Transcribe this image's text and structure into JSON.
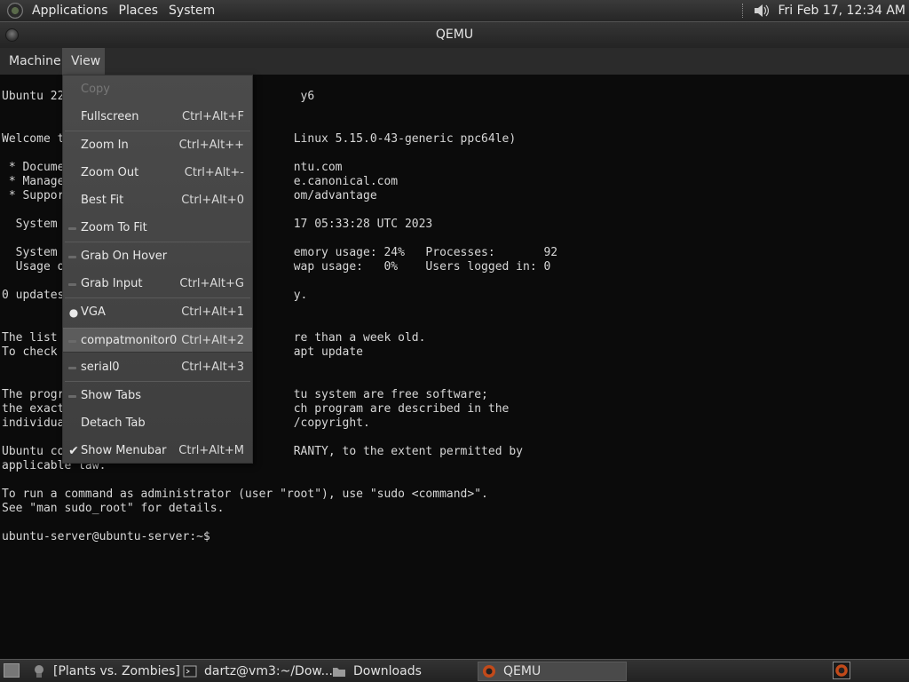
{
  "top_panel": {
    "menus": [
      "Applications",
      "Places",
      "System"
    ],
    "clock": "Fri Feb 17, 12:34 AM"
  },
  "window": {
    "title": "QEMU"
  },
  "menubar": {
    "items": [
      "Machine",
      "View"
    ]
  },
  "view_menu": {
    "items": [
      {
        "label": "Copy",
        "shortcut": "",
        "disabled": true,
        "mark": ""
      },
      {
        "label": "Fullscreen",
        "shortcut": "Ctrl+Alt+F",
        "mark": ""
      },
      {
        "label": "Zoom In",
        "shortcut": "Ctrl+Alt++",
        "mark": ""
      },
      {
        "label": "Zoom Out",
        "shortcut": "Ctrl+Alt+-",
        "mark": ""
      },
      {
        "label": "Best Fit",
        "shortcut": "Ctrl+Alt+0",
        "mark": ""
      },
      {
        "label": "Zoom To Fit",
        "shortcut": "",
        "mark": "toggle-off"
      },
      {
        "label": "Grab On Hover",
        "shortcut": "",
        "mark": "toggle-off"
      },
      {
        "label": "Grab Input",
        "shortcut": "Ctrl+Alt+G",
        "mark": "toggle-off"
      },
      {
        "label": "VGA",
        "shortcut": "Ctrl+Alt+1",
        "mark": "radio-on"
      },
      {
        "label": "compatmonitor0",
        "shortcut": "Ctrl+Alt+2",
        "mark": "radio-off",
        "highlighted": true
      },
      {
        "label": "serial0",
        "shortcut": "Ctrl+Alt+3",
        "mark": "radio-off"
      },
      {
        "label": "Show Tabs",
        "shortcut": "",
        "mark": "toggle-off"
      },
      {
        "label": "Detach Tab",
        "shortcut": "",
        "mark": ""
      },
      {
        "label": "Show Menubar",
        "shortcut": "Ctrl+Alt+M",
        "mark": "check-on"
      }
    ]
  },
  "terminal": {
    "lines": [
      "Ubuntu 22                                  y6",
      "Welcome t                                 Linux 5.15.0-43-generic ppc64le)",
      " * Docume                                 ntu.com",
      " * Manage                                 e.canonical.com",
      " * Suppor                                 om/advantage",
      "  System                                  17 05:33:28 UTC 2023",
      "  System                                  emory usage: 24%   Processes:       92",
      "  Usage o                                 wap usage:   0%    Users logged in: 0",
      "0 updates                                 y.",
      "The list                                  re than a week old.",
      "To check                                  apt update",
      "The progr                                 tu system are free software;",
      "the exact                                 ch program are described in the",
      "individua                                 /copyright.",
      "Ubuntu co                                 RANTY, to the extent permitted by",
      "applicable law.",
      "To run a command as administrator (user \"root\"), use \"sudo <command>\".",
      "See \"man sudo_root\" for details.",
      "ubuntu-server@ubuntu-server:~$"
    ]
  },
  "taskbar": {
    "items": [
      "[Plants vs. Zombies]",
      "dartz@vm3:~/Dow...",
      "Downloads",
      "QEMU"
    ]
  },
  "icons": {
    "app_logo": "gnome-foot-icon",
    "volume": "speaker-icon",
    "window_close": "window-close-icon",
    "show_desktop": "desktop-icon"
  }
}
